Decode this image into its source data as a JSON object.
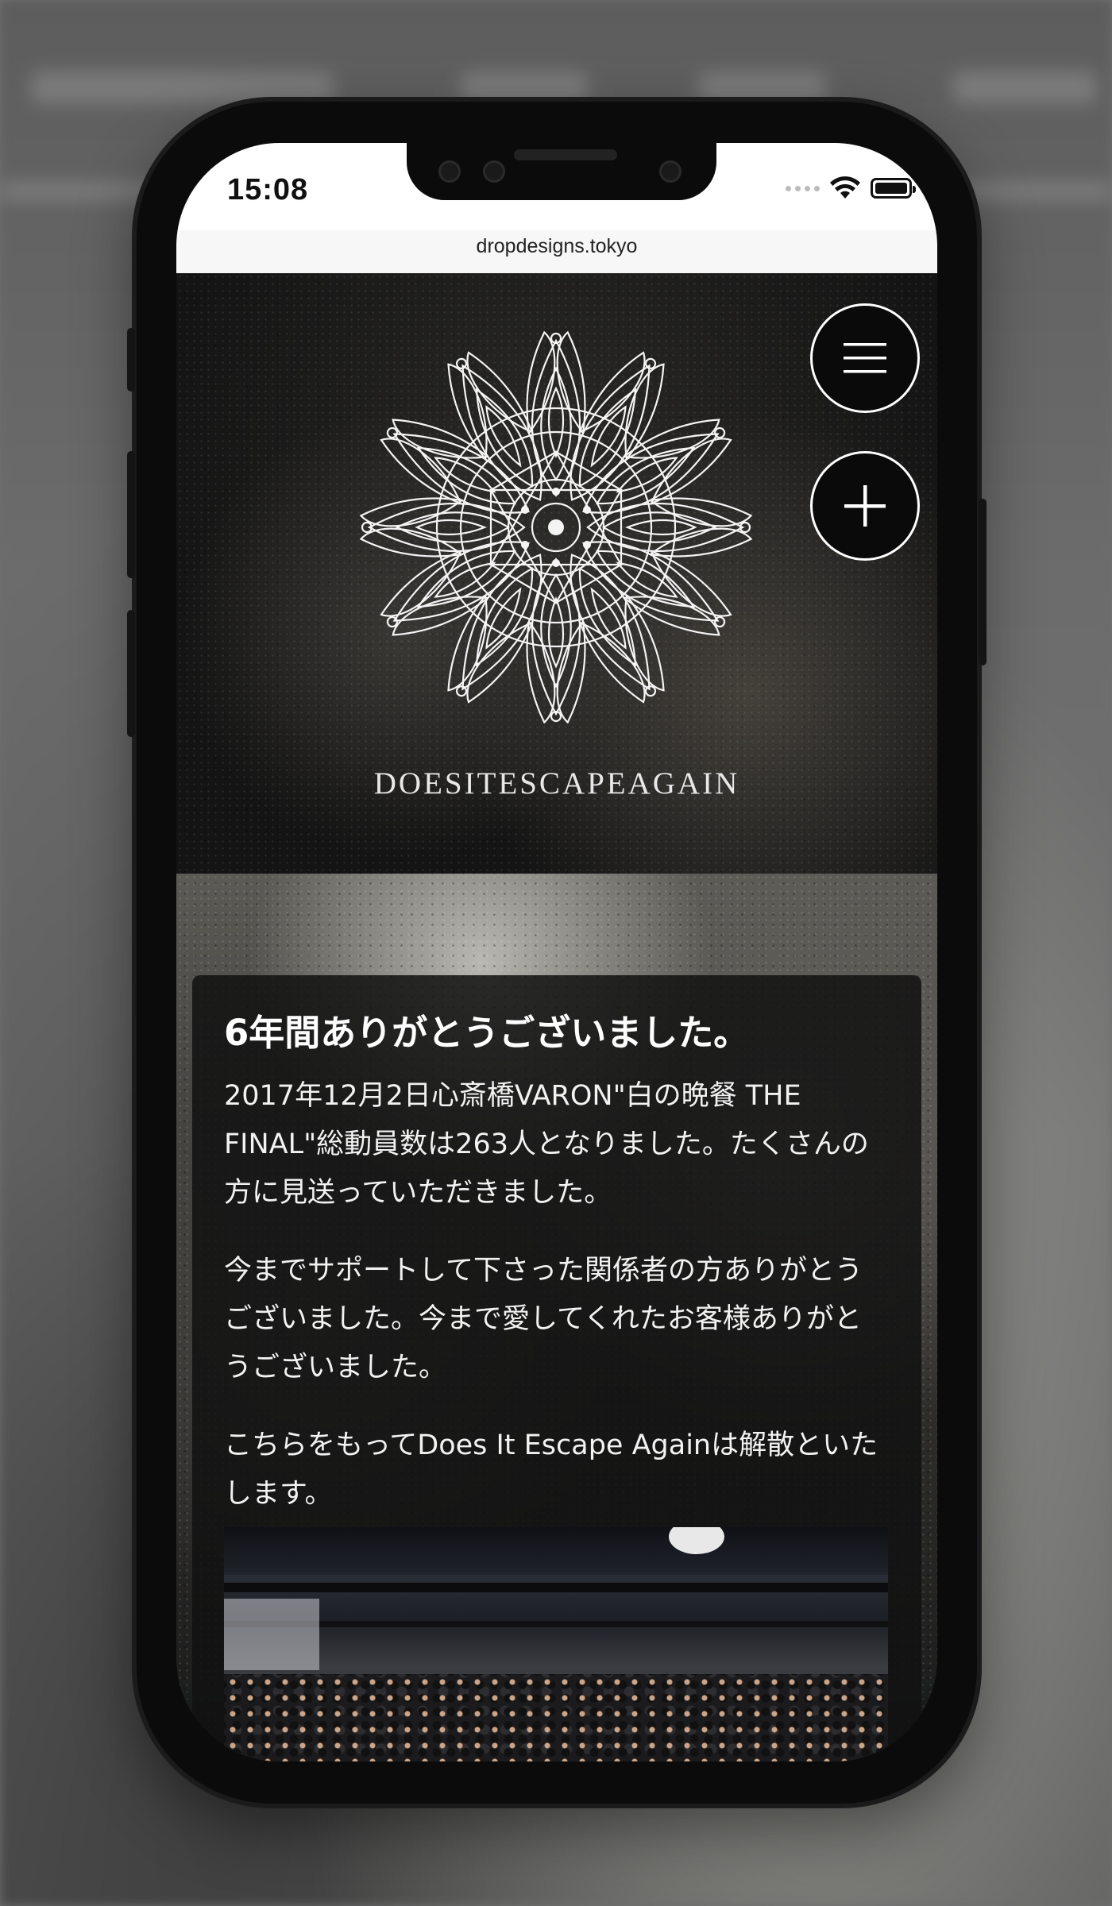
{
  "status_bar": {
    "time": "15:08"
  },
  "browser": {
    "url": "dropdesigns.tokyo"
  },
  "header": {
    "band_name": "DOESITESCAPEAGAIN",
    "menu_icon": "hamburger-menu-icon",
    "plus_icon": "plus-icon"
  },
  "post": {
    "title": "6年間ありがとうございました。",
    "paragraphs": [
      "2017年12月2日心斎橋VARON\"白の晩餐 THE FINAL\"総動員数は263人となりました。たくさんの方に見送っていただきました。",
      "今までサポートして下さった関係者の方ありがとうございました。今まで愛してくれたお客様ありがとうございました。",
      "こちらをもってDoes It Escape Againは解散といたします。"
    ]
  },
  "colors": {
    "card_background": "#121212",
    "text": "#ffffff",
    "button_border": "#ffffff"
  }
}
